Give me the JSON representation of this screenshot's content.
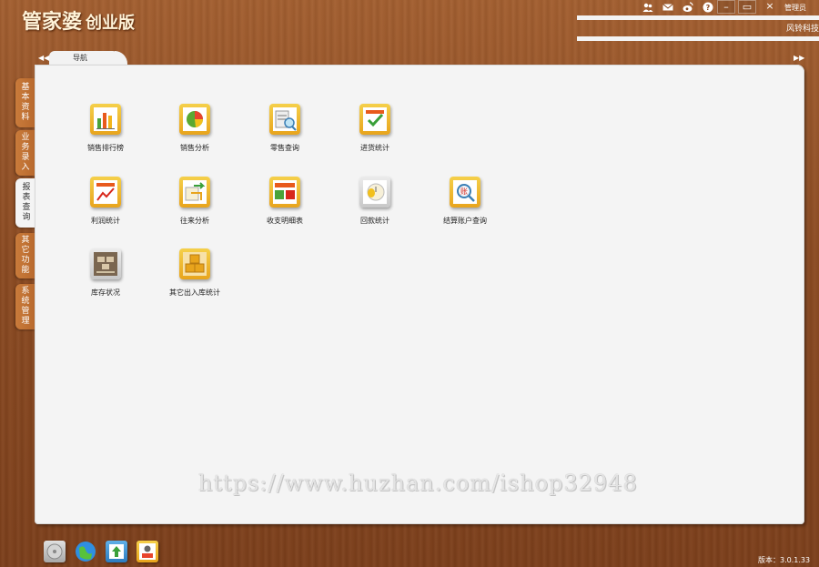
{
  "app": {
    "title": "管家婆",
    "edition": "创业版"
  },
  "header": {
    "user_label": "管理员",
    "company": "风铃科技",
    "icons": [
      "users-icon",
      "mail-icon",
      "weibo-icon",
      "help-icon"
    ],
    "window_buttons": {
      "minimize": "–",
      "restore": "▭",
      "close": "×"
    }
  },
  "tabs": {
    "nav_label": "导航",
    "prev": "◀◀",
    "next": "▶▶"
  },
  "side_tabs": [
    {
      "label": "基本资料",
      "active": false
    },
    {
      "label": "业务录入",
      "active": false
    },
    {
      "label": "报表查询",
      "active": true
    },
    {
      "label": "其它功能",
      "active": false
    },
    {
      "label": "系统管理",
      "active": false
    }
  ],
  "grid": [
    {
      "label": "销售排行榜",
      "icon": "bar-chart-icon"
    },
    {
      "label": "销售分析",
      "icon": "pie-chart-icon"
    },
    {
      "label": "零售查询",
      "icon": "receipt-search-icon"
    },
    {
      "label": "进货统计",
      "icon": "checklist-icon"
    },
    {
      "label": "利润统计",
      "icon": "profit-trend-icon"
    },
    {
      "label": "往来分析",
      "icon": "transfer-icon"
    },
    {
      "label": "收支明细表",
      "icon": "ledger-icon"
    },
    {
      "label": "回款统计",
      "icon": "clock-money-icon"
    },
    {
      "label": "结算账户查询",
      "icon": "account-search-icon"
    },
    {
      "label": "库存状况",
      "icon": "stock-pallet-icon"
    },
    {
      "label": "其它出入库统计",
      "icon": "boxes-icon"
    }
  ],
  "watermark": "https://www.huzhan.com/ishop32948",
  "taskbar": [
    "disc-icon",
    "globe-icon",
    "upload-icon",
    "user-switch-icon"
  ],
  "version": "版本：3.0.1.33",
  "colors": {
    "wood": "#8c4b22",
    "panel": "#f4f4f4",
    "side_tab": "#c97b3b",
    "icon_frame": "#f0a624"
  }
}
